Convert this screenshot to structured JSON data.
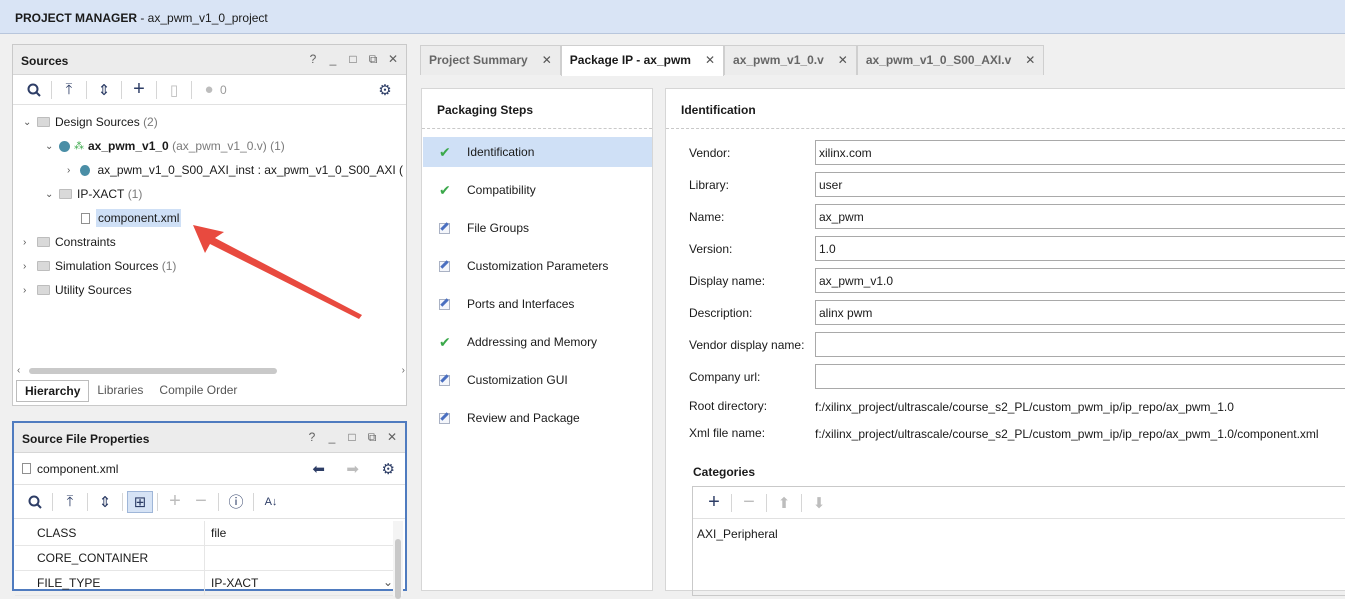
{
  "titlebar": {
    "label": "PROJECT MANAGER",
    "project": " - ax_pwm_v1_0_project"
  },
  "sources": {
    "title": "Sources",
    "count": "0",
    "tree": {
      "design_sources": {
        "label": "Design Sources",
        "count": "(2)"
      },
      "ax_pwm": {
        "label": "ax_pwm_v1_0",
        "file": "(ax_pwm_v1_0.v)",
        "count": "(1)"
      },
      "axi_inst": {
        "label": "ax_pwm_v1_0_S00_AXI_inst : ax_pwm_v1_0_S00_AXI ("
      },
      "ipxact": {
        "label": "IP-XACT",
        "count": "(1)"
      },
      "component": {
        "label": "component.xml"
      },
      "constraints": {
        "label": "Constraints"
      },
      "simulation": {
        "label": "Simulation Sources",
        "count": "(1)"
      },
      "utility": {
        "label": "Utility Sources"
      }
    },
    "tabs": [
      "Hierarchy",
      "Libraries",
      "Compile Order"
    ]
  },
  "sfp": {
    "title": "Source File Properties",
    "file": "component.xml",
    "rows": [
      {
        "key": "CLASS",
        "value": "file"
      },
      {
        "key": "CORE_CONTAINER",
        "value": ""
      },
      {
        "key": "FILE_TYPE",
        "value": "IP-XACT"
      }
    ]
  },
  "doc_tabs": [
    "Project Summary",
    "Package IP - ax_pwm",
    "ax_pwm_v1_0.v",
    "ax_pwm_v1_0_S00_AXI.v"
  ],
  "packaging": {
    "title": "Packaging Steps",
    "steps": [
      {
        "label": "Identification",
        "status": "done"
      },
      {
        "label": "Compatibility",
        "status": "done"
      },
      {
        "label": "File Groups",
        "status": "edit"
      },
      {
        "label": "Customization Parameters",
        "status": "edit"
      },
      {
        "label": "Ports and Interfaces",
        "status": "edit"
      },
      {
        "label": "Addressing and Memory",
        "status": "done"
      },
      {
        "label": "Customization GUI",
        "status": "edit"
      },
      {
        "label": "Review and Package",
        "status": "edit"
      }
    ]
  },
  "identification": {
    "title": "Identification",
    "vendor": {
      "label": "Vendor:",
      "value": "xilinx.com"
    },
    "library": {
      "label": "Library:",
      "value": "user"
    },
    "name": {
      "label": "Name:",
      "value": "ax_pwm"
    },
    "version": {
      "label": "Version:",
      "value": "1.0"
    },
    "display_name": {
      "label": "Display name:",
      "value": "ax_pwm_v1.0"
    },
    "description": {
      "label": "Description:",
      "value": "alinx pwm"
    },
    "vendor_display_name": {
      "label": "Vendor display name:",
      "value": ""
    },
    "company_url": {
      "label": "Company url:",
      "value": ""
    },
    "root_dir": {
      "label": "Root directory:",
      "value": "f:/xilinx_project/ultrascale/course_s2_PL/custom_pwm_ip/ip_repo/ax_pwm_1.0"
    },
    "xml_file": {
      "label": "Xml file name:",
      "value": "f:/xilinx_project/ultrascale/course_s2_PL/custom_pwm_ip/ip_repo/ax_pwm_1.0/component.xml"
    }
  },
  "categories": {
    "title": "Categories",
    "items": [
      "AXI_Peripheral"
    ]
  },
  "colors": {
    "titlebar": "#d9e4f5",
    "selection": "#cfe0f6",
    "check": "#3aa84a",
    "arrow": "#e84a3f"
  }
}
